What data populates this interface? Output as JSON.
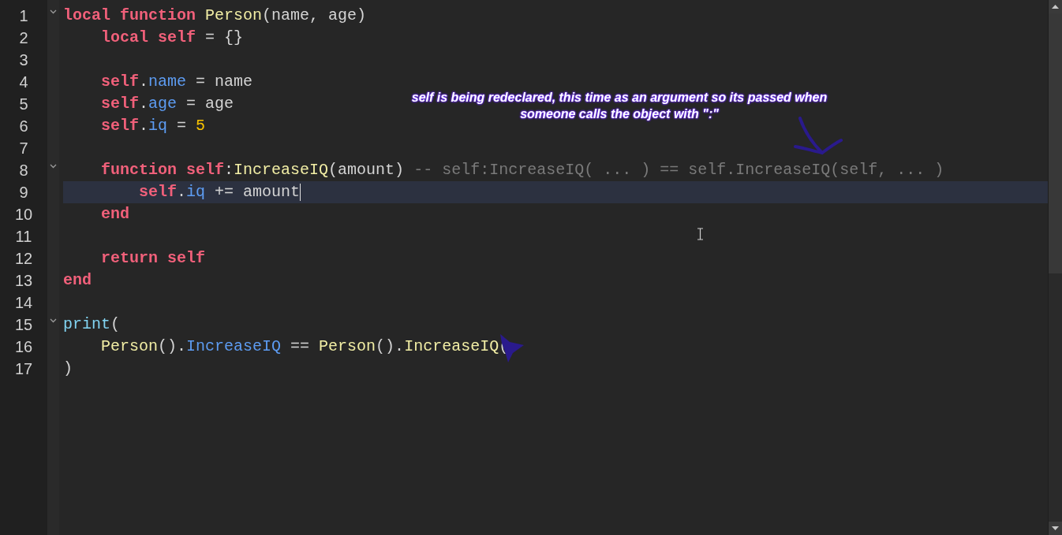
{
  "editor": {
    "lines": [
      {
        "number": "1",
        "fold": true,
        "current": false,
        "tokens": [
          {
            "text": "local function ",
            "kind": "keyword"
          },
          {
            "text": "Person",
            "kind": "function"
          },
          {
            "text": "(name, age)",
            "kind": "plain"
          }
        ]
      },
      {
        "number": "2",
        "fold": false,
        "current": false,
        "tokens": [
          {
            "text": "    local self",
            "kind": "keyword"
          },
          {
            "text": " = {}",
            "kind": "plain"
          }
        ]
      },
      {
        "number": "3",
        "fold": false,
        "current": false
      },
      {
        "number": "4",
        "fold": false,
        "current": false,
        "tokens": [
          {
            "text": "    self",
            "kind": "keyword"
          },
          {
            "text": ".",
            "kind": "plain"
          },
          {
            "text": "name",
            "kind": "field"
          },
          {
            "text": " = name",
            "kind": "plain"
          }
        ]
      },
      {
        "number": "5",
        "fold": false,
        "current": false,
        "tokens": [
          {
            "text": "    self",
            "kind": "keyword"
          },
          {
            "text": ".",
            "kind": "plain"
          },
          {
            "text": "age",
            "kind": "field"
          },
          {
            "text": " = age",
            "kind": "plain"
          }
        ]
      },
      {
        "number": "6",
        "fold": false,
        "current": false,
        "tokens": [
          {
            "text": "    self",
            "kind": "keyword"
          },
          {
            "text": ".",
            "kind": "plain"
          },
          {
            "text": "iq",
            "kind": "field"
          },
          {
            "text": " = ",
            "kind": "plain"
          },
          {
            "text": "5",
            "kind": "number"
          }
        ]
      },
      {
        "number": "7",
        "fold": false,
        "current": false
      },
      {
        "number": "8",
        "fold": true,
        "current": false,
        "tokens": [
          {
            "text": "    function self",
            "kind": "keyword"
          },
          {
            "text": ":",
            "kind": "plain"
          },
          {
            "text": "IncreaseIQ",
            "kind": "function"
          },
          {
            "text": "(amount) ",
            "kind": "plain"
          },
          {
            "text": "-- self:IncreaseIQ( ... ) == self.IncreaseIQ(self, ... )",
            "kind": "comment"
          }
        ]
      },
      {
        "number": "9",
        "fold": false,
        "current": true,
        "tokens": [
          {
            "text": "        self",
            "kind": "keyword"
          },
          {
            "text": ".",
            "kind": "plain"
          },
          {
            "text": "iq",
            "kind": "field"
          },
          {
            "text": " += amount",
            "kind": "plain"
          }
        ]
      },
      {
        "number": "10",
        "fold": false,
        "current": false,
        "tokens": [
          {
            "text": "    end",
            "kind": "keyword"
          }
        ]
      },
      {
        "number": "11",
        "fold": false,
        "current": false
      },
      {
        "number": "12",
        "fold": false,
        "current": false,
        "tokens": [
          {
            "text": "    return self",
            "kind": "keyword"
          }
        ]
      },
      {
        "number": "13",
        "fold": false,
        "current": false,
        "tokens": [
          {
            "text": "end",
            "kind": "keyword"
          }
        ]
      },
      {
        "number": "14",
        "fold": false,
        "current": false
      },
      {
        "number": "15",
        "fold": true,
        "current": false,
        "tokens": [
          {
            "text": "print",
            "kind": "builtin"
          },
          {
            "text": "(",
            "kind": "plain"
          }
        ]
      },
      {
        "number": "16",
        "fold": false,
        "current": false,
        "tokens": [
          {
            "text": "    Person",
            "kind": "function"
          },
          {
            "text": "().",
            "kind": "plain"
          },
          {
            "text": "IncreaseIQ",
            "kind": "field"
          },
          {
            "text": " == ",
            "kind": "plain"
          },
          {
            "text": "Person",
            "kind": "function"
          },
          {
            "text": "().",
            "kind": "plain"
          },
          {
            "text": "IncreaseIQ",
            "kind": "function"
          },
          {
            "text": "(",
            "kind": "plain"
          }
        ]
      },
      {
        "number": "17",
        "fold": false,
        "current": false,
        "tokens": [
          {
            "text": ")",
            "kind": "plain"
          }
        ]
      }
    ]
  },
  "annotation": {
    "lines": [
      "self is being redeclared, this time as an argument so its passed when",
      "someone calls the object with \":\""
    ]
  }
}
